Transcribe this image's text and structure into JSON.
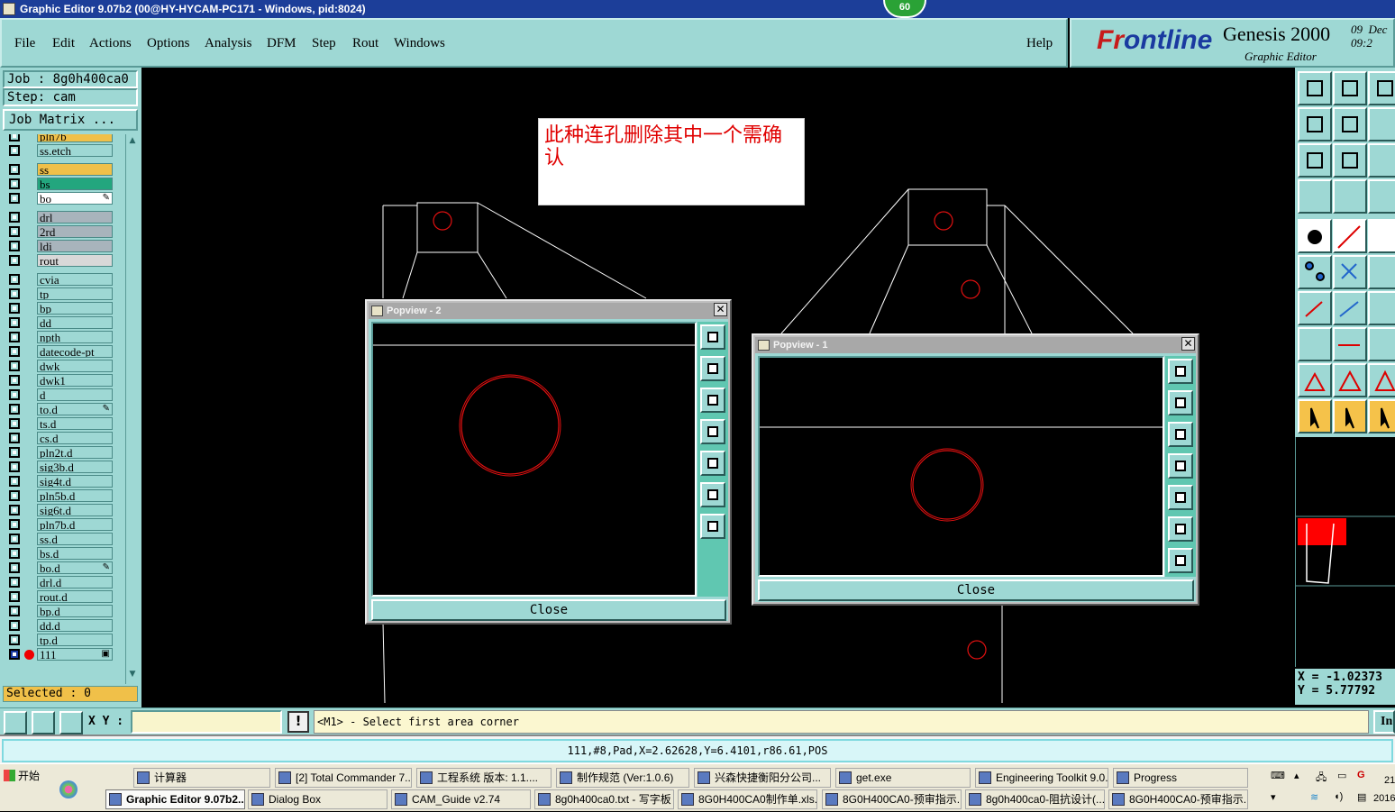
{
  "window": {
    "title": "Graphic Editor 9.07b2 (00@HY-HYCAM-PC171 - Windows, pid:8024)",
    "badge": "60"
  },
  "menu": {
    "items": [
      "File",
      "Edit",
      "Actions",
      "Options",
      "Analysis",
      "DFM",
      "Step",
      "Rout",
      "Windows"
    ],
    "help": "Help"
  },
  "brand": {
    "logo_a": "Fr",
    "logo_b": "ontline",
    "product": "Genesis 2000",
    "subtitle": "Graphic Editor",
    "date": "09  Dec\n09:2"
  },
  "job": {
    "job_label": "Job : 8g0h400ca0",
    "step_label": "Step: cam",
    "job_matrix": "Job Matrix ..."
  },
  "layers": [
    {
      "name": "pln7b",
      "color": "#f0c049",
      "tag": ""
    },
    {
      "name": "ss.etch",
      "color": "#9ed8d4",
      "tag": ""
    },
    {
      "name": "ss",
      "color": "#f0c049",
      "tag": ""
    },
    {
      "name": "bs",
      "color": "#23a67e",
      "tag": ""
    },
    {
      "name": "bo",
      "color": "#ffffff",
      "tag": "✎"
    },
    {
      "name": "drl",
      "color": "#a8b4bc",
      "tag": ""
    },
    {
      "name": "2rd",
      "color": "#a8b4bc",
      "tag": ""
    },
    {
      "name": "ldi",
      "color": "#a8b4bc",
      "tag": ""
    },
    {
      "name": "rout",
      "color": "#d8d8d8",
      "tag": ""
    },
    {
      "name": "cvia",
      "color": "#9ed8d4",
      "tag": ""
    },
    {
      "name": "tp",
      "color": "#9ed8d4",
      "tag": ""
    },
    {
      "name": "bp",
      "color": "#9ed8d4",
      "tag": ""
    },
    {
      "name": "dd",
      "color": "#9ed8d4",
      "tag": ""
    },
    {
      "name": "npth",
      "color": "#9ed8d4",
      "tag": ""
    },
    {
      "name": "datecode-pt",
      "color": "#9ed8d4",
      "tag": ""
    },
    {
      "name": "dwk",
      "color": "#9ed8d4",
      "tag": ""
    },
    {
      "name": "dwk1",
      "color": "#9ed8d4",
      "tag": ""
    },
    {
      "name": "d",
      "color": "#9ed8d4",
      "tag": ""
    },
    {
      "name": "to.d",
      "color": "#9ed8d4",
      "tag": "✎"
    },
    {
      "name": "ts.d",
      "color": "#9ed8d4",
      "tag": ""
    },
    {
      "name": "cs.d",
      "color": "#9ed8d4",
      "tag": ""
    },
    {
      "name": "pln2t.d",
      "color": "#9ed8d4",
      "tag": ""
    },
    {
      "name": "sig3b.d",
      "color": "#9ed8d4",
      "tag": ""
    },
    {
      "name": "sig4t.d",
      "color": "#9ed8d4",
      "tag": ""
    },
    {
      "name": "pln5b.d",
      "color": "#9ed8d4",
      "tag": ""
    },
    {
      "name": "sig6t.d",
      "color": "#9ed8d4",
      "tag": ""
    },
    {
      "name": "pln7b.d",
      "color": "#9ed8d4",
      "tag": ""
    },
    {
      "name": "ss.d",
      "color": "#9ed8d4",
      "tag": ""
    },
    {
      "name": "bs.d",
      "color": "#9ed8d4",
      "tag": ""
    },
    {
      "name": "bo.d",
      "color": "#9ed8d4",
      "tag": "✎"
    },
    {
      "name": "drl.d",
      "color": "#9ed8d4",
      "tag": ""
    },
    {
      "name": "rout.d",
      "color": "#9ed8d4",
      "tag": ""
    },
    {
      "name": "bp.d",
      "color": "#9ed8d4",
      "tag": ""
    },
    {
      "name": "dd.d",
      "color": "#9ed8d4",
      "tag": ""
    },
    {
      "name": "tp.d",
      "color": "#9ed8d4",
      "tag": ""
    },
    {
      "name": "111",
      "color": "#9ed8d4",
      "tag": "▣",
      "work": true
    }
  ],
  "selected": "Selected : 0",
  "note": "此种连孔删除其中一个需确认",
  "popview2": {
    "title": "Popview - 2",
    "close": "Close"
  },
  "popview1": {
    "title": "Popview - 1",
    "close": "Close"
  },
  "coords": {
    "x": "X = -1.02373",
    "y": "Y =  5.77792"
  },
  "cmd": {
    "xy_label": "X Y :",
    "input_value": "",
    "bang": "!",
    "prompt": "<M1> - Select first area corner",
    "right_btn": "In"
  },
  "status": "111,#8,Pad,X=2.62628,Y=6.4101,r86.61,POS",
  "taskbar": {
    "start": "开始",
    "row1": [
      "计算器",
      "[2] Total Commander 7...",
      "工程系统  版本: 1.1....",
      "制作规范 (Ver:1.0.6)",
      "兴森快捷衡阳分公司...",
      "get.exe",
      "Engineering Toolkit 9.0...",
      "Progress"
    ],
    "row2": [
      "Graphic Editor 9.07b2...",
      "Dialog Box",
      "CAM_Guide v2.74",
      "8g0h400ca0.txt - 写字板",
      "8G0H400CA0制作单.xls...",
      "8G0H400CA0-预审指示...",
      "8g0h400ca0-阻抗设计(...",
      "8G0H400CA0-预审指示..."
    ],
    "clock_a": "21",
    "clock_b": "2016"
  },
  "colors": {
    "teal": "#9ed8d4",
    "orange": "#f0c049",
    "red": "#e00000"
  }
}
